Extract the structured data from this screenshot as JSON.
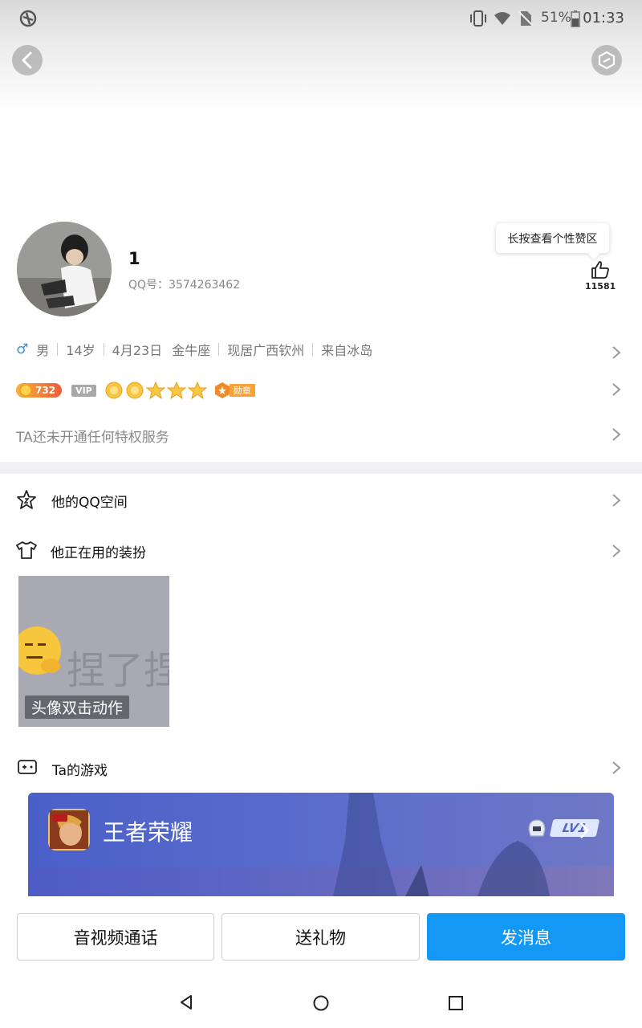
{
  "status_bar": {
    "battery": "51%",
    "time": "01:33"
  },
  "profile": {
    "nickname": "1",
    "qq_label": "QQ号：3574263462",
    "like_tooltip": "长按查看个性赞区",
    "like_count": "11581"
  },
  "info": {
    "gender_symbol": "♂",
    "gender": "男",
    "age": "14岁",
    "birthday": "4月23日",
    "zodiac": "金牛座",
    "location": "现居广西钦州",
    "hometown": "来自冰岛"
  },
  "badges": {
    "points": "732",
    "vip": "VIP",
    "medal": "勋章"
  },
  "privilege_text": "TA还未开通任何特权服务",
  "menu": {
    "qzone": "他的QQ空间",
    "outfit": "他正在用的装扮",
    "action_text": "捏了捏",
    "action_caption": "头像双击动作",
    "games": "Ta的游戏"
  },
  "game": {
    "name": "王者荣耀",
    "level": "LV1"
  },
  "buttons": {
    "call": "音视频通话",
    "gift": "送礼物",
    "message": "发消息"
  },
  "colors": {
    "primary": "#1399f5",
    "gender": "#3a8fd9",
    "points": "#ee5c3c",
    "medal": "#f7a23b"
  }
}
